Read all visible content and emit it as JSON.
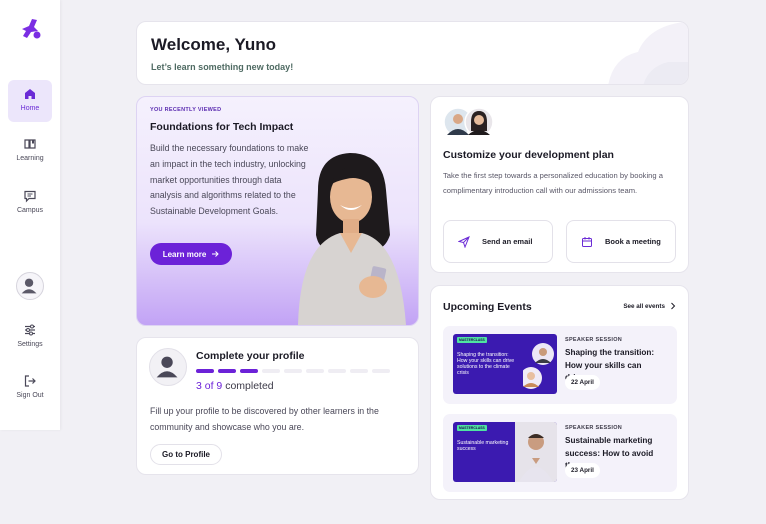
{
  "sidebar": {
    "items": [
      {
        "label": "Home",
        "icon": "home-icon",
        "active": true
      },
      {
        "label": "Learning",
        "icon": "book-icon"
      },
      {
        "label": "Campus",
        "icon": "chat-icon"
      },
      {
        "label": "Settings",
        "icon": "sliders-icon"
      },
      {
        "label": "Sign Out",
        "icon": "sign-out-icon"
      }
    ]
  },
  "welcome": {
    "title": "Welcome, Yuno",
    "subtitle": "Let’s learn something new today!"
  },
  "recent": {
    "eyebrow": "YOU RECENTLY VIEWED",
    "title": "Foundations for Tech Impact",
    "description": "Build the necessary foundations to make an impact in the tech industry, unlocking market opportunities through data analysis and algorithms related to the Sustainable Development Goals.",
    "button": "Learn more"
  },
  "profile": {
    "title": "Complete your profile",
    "completed": 3,
    "total": 9,
    "count_prefix": "3 of 9",
    "count_suffix": " completed",
    "body": "Fill up your profile to be discovered by other learners in the community and showcase who you are.",
    "button": "Go to Profile"
  },
  "customize": {
    "title": "Customize your development plan",
    "body": "Take the first step towards a personalized education by booking a complimentary introduction call with our admissions team.",
    "email_label": "Send an email",
    "meeting_label": "Book a meeting"
  },
  "events": {
    "title": "Upcoming Events",
    "see_all": "See all events",
    "items": [
      {
        "kind": "SPEAKER SESSION",
        "title": "Shaping the transition: How your skills can drive...",
        "date": "22 April",
        "thumb_title": "Shaping the transition: How your skills can drive solutions to the climate crisis"
      },
      {
        "kind": "SPEAKER SESSION",
        "title": "Sustainable marketing success: How to avoid the...",
        "date": "23 April",
        "thumb_title": "Sustainable marketing success"
      }
    ]
  },
  "colors": {
    "accent": "#6c22d8",
    "background": "#f1f0f5",
    "active_nav_bg": "#ece6fb",
    "subtitle_green": "#4f6b63"
  }
}
